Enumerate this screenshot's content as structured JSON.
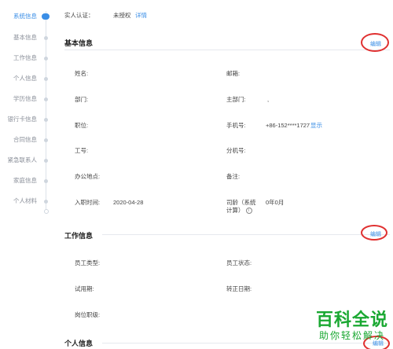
{
  "nav": {
    "items": [
      {
        "label": "系统信息",
        "active": true
      },
      {
        "label": "基本信息",
        "active": false
      },
      {
        "label": "工作信息",
        "active": false
      },
      {
        "label": "个人信息",
        "active": false
      },
      {
        "label": "学历信息",
        "active": false
      },
      {
        "label": "银行卡信息",
        "active": false
      },
      {
        "label": "合同信息",
        "active": false
      },
      {
        "label": "紧急联系人",
        "active": false
      },
      {
        "label": "家庭信息",
        "active": false
      },
      {
        "label": "个人材料",
        "active": false
      }
    ]
  },
  "system": {
    "auth_label": "实人认证：",
    "auth_value": "未授权",
    "detail_link": "详情"
  },
  "basic": {
    "title": "基本信息",
    "edit": "编辑",
    "name_label": "姓名:",
    "email_label": "邮箱:",
    "dept_label": "部门:",
    "main_dept_label": "主部门:",
    "main_dept_value": ",",
    "position_label": "职位:",
    "phone_label": "手机号:",
    "phone_value": "+86-152****1727",
    "phone_show": "显示",
    "job_no_label": "工号:",
    "ext_label": "分机号:",
    "office_label": "办公地点:",
    "remark_label": "备注:",
    "hire_label": "入职时间:",
    "hire_value": "2020-04-28",
    "tenure_label_1": "司龄（系统",
    "tenure_label_2": "计算）",
    "tenure_value": "0年0月",
    "info_icon": "ⓘ"
  },
  "work": {
    "title": "工作信息",
    "edit": "编辑",
    "type_label": "员工类型:",
    "status_label": "员工状态:",
    "probation_label": "试用期:",
    "regular_label": "转正日期:",
    "rank_label": "岗位职级:"
  },
  "personal": {
    "title": "个人信息",
    "edit": "编辑"
  },
  "watermark": {
    "title": "百科全说",
    "subtitle": "助你轻松解决"
  }
}
